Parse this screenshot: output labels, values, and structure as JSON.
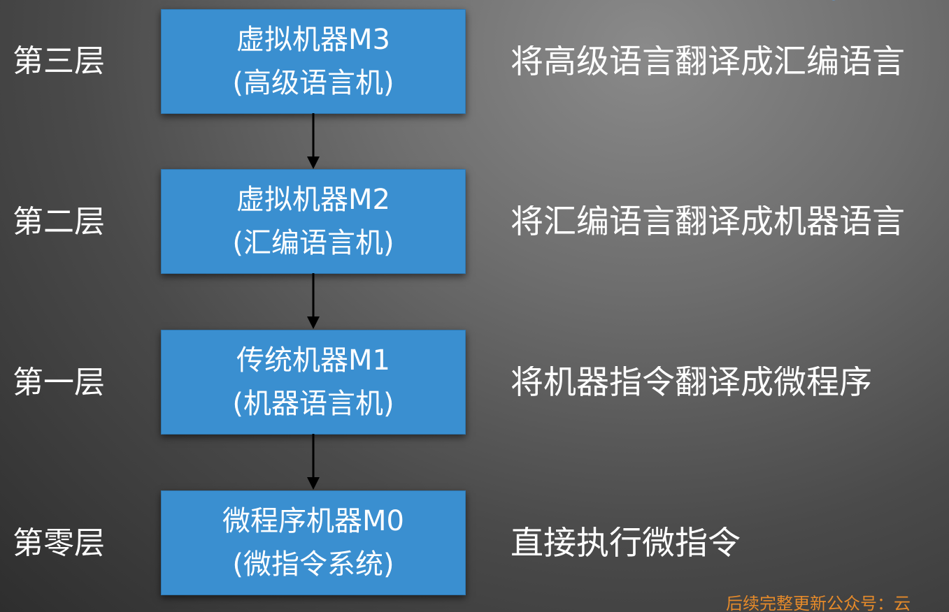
{
  "layers": [
    {
      "level": "第三层",
      "machine": "虚拟机器M3",
      "sub": "(高级语言机)",
      "desc": "将高级语言翻译成汇编语言"
    },
    {
      "level": "第二层",
      "machine": "虚拟机器M2",
      "sub": "(汇编语言机)",
      "desc": "将汇编语言翻译成机器语言"
    },
    {
      "level": "第一层",
      "machine": "传统机器M1",
      "sub": "(机器语言机)",
      "desc": "将机器指令翻译成微程序"
    },
    {
      "level": "第零层",
      "machine": "微程序机器M0",
      "sub": "(微指令系统)",
      "desc": "直接执行微指令"
    }
  ],
  "watermark": "后续完整更新公众号：云",
  "colors": {
    "box": "#3a8fd0",
    "text": "#ffffff",
    "watermark": "#e58a2a"
  }
}
